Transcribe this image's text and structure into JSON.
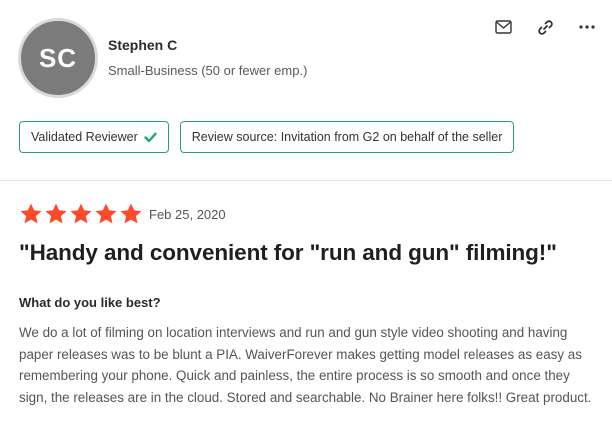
{
  "reviewer": {
    "initials": "SC",
    "name": "Stephen C",
    "segment": "Small-Business (50 or fewer emp.)"
  },
  "actions": {
    "icons": [
      "mail-icon",
      "link-icon",
      "more-icon"
    ]
  },
  "badges": {
    "validated": "Validated Reviewer",
    "source": "Review source: Invitation from G2 on behalf of the seller"
  },
  "review": {
    "rating": 5,
    "date": "Feb 25, 2020",
    "title": "\"Handy and convenient for \"run and gun\" filming!\"",
    "question": "What do you like best?",
    "answer": "We do a lot of filming on location interviews and run and gun style video shooting and having paper releases was to be blunt a PIA. WaiverForever makes getting model releases as easy as remembering your phone. Quick and painless, the entire process is so smooth and once they sign, the releases are in the cloud. Stored and searchable. No Brainer here folks!! Great product."
  },
  "colors": {
    "star": "#ff492c",
    "badge_border": "#27a17d",
    "avatar_bg": "#7b7b7b"
  }
}
